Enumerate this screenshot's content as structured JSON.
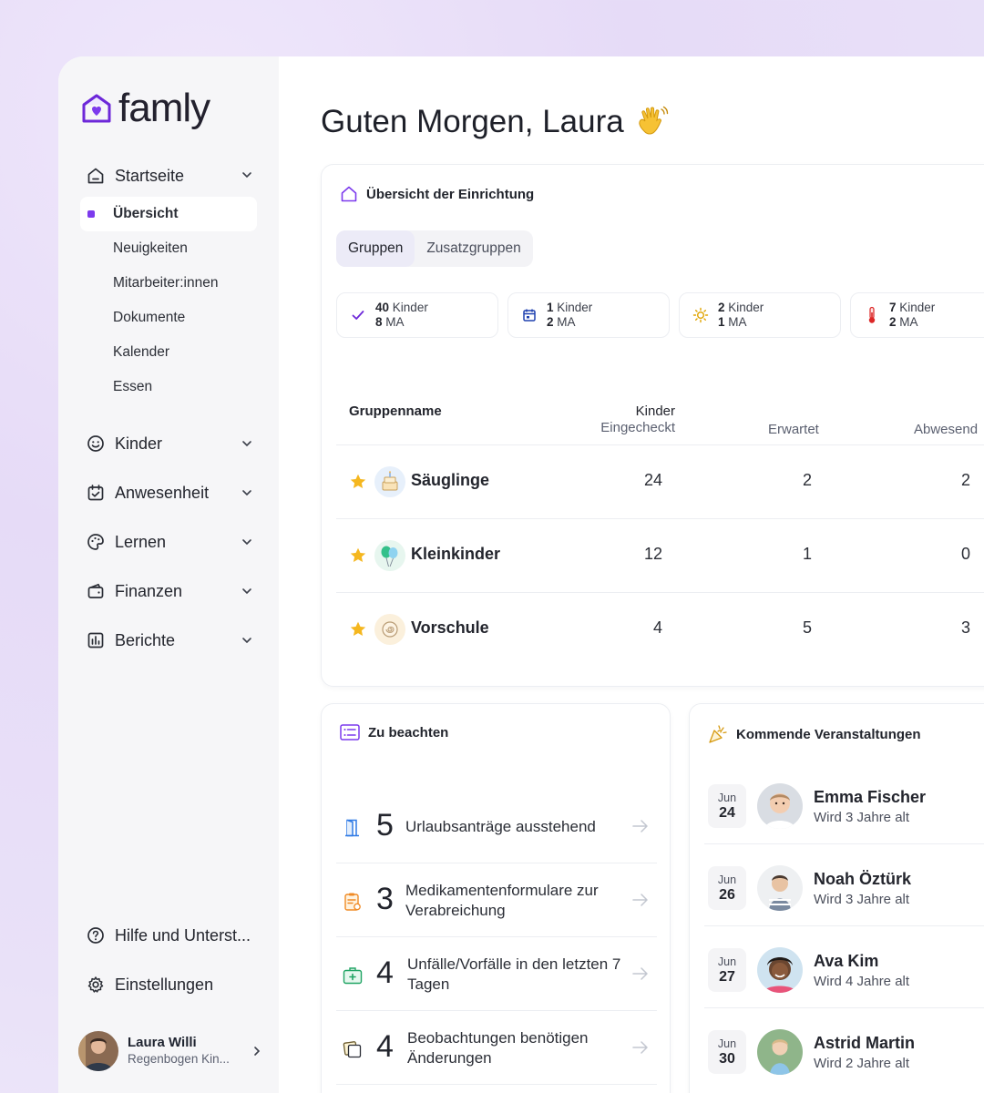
{
  "brand": {
    "name": "famly",
    "accent": "#7c3aed"
  },
  "greeting": {
    "text": "Guten Morgen, Laura"
  },
  "sidebar": {
    "home": {
      "label": "Startseite",
      "icon": "home-icon"
    },
    "subitems": [
      {
        "label": "Übersicht",
        "active": true
      },
      {
        "label": "Neuigkeiten"
      },
      {
        "label": "Mitarbeiter:innen"
      },
      {
        "label": "Dokumente"
      },
      {
        "label": "Kalender"
      },
      {
        "label": "Essen"
      }
    ],
    "sections": [
      {
        "label": "Kinder",
        "icon": "smiley-icon"
      },
      {
        "label": "Anwesenheit",
        "icon": "calendar-check-icon"
      },
      {
        "label": "Lernen",
        "icon": "palette-icon"
      },
      {
        "label": "Finanzen",
        "icon": "wallet-icon"
      },
      {
        "label": "Berichte",
        "icon": "chart-icon"
      }
    ],
    "help": {
      "label": "Hilfe und Unterst..."
    },
    "settings": {
      "label": "Einstellungen"
    },
    "profile": {
      "name": "Laura Willi",
      "org": "Regenbogen Kin..."
    }
  },
  "overview": {
    "title": "Übersicht der Einrichtung",
    "tabs": [
      {
        "label": "Gruppen",
        "active": true
      },
      {
        "label": "Zusatzgruppen"
      }
    ],
    "stats": [
      {
        "kids": "40",
        "kids_label": "Kinder",
        "staff": "8",
        "staff_label": "MA",
        "icon": "check-icon"
      },
      {
        "kids": "1",
        "kids_label": "Kinder",
        "staff": "2",
        "staff_label": "MA",
        "icon": "calendar-icon"
      },
      {
        "kids": "2",
        "kids_label": "Kinder",
        "staff": "1",
        "staff_label": "MA",
        "icon": "sun-icon"
      },
      {
        "kids": "7",
        "kids_label": "Kinder",
        "staff": "2",
        "staff_label": "MA",
        "icon": "thermometer-icon"
      }
    ],
    "columns": {
      "name": "Gruppenname",
      "checked_1": "Kinder",
      "checked_2": "Eingecheckt",
      "expected": "Erwartet",
      "absent": "Abwesend"
    },
    "rows": [
      {
        "name": "Säuglinge",
        "checked": "24",
        "expected": "2",
        "absent": "2",
        "icon": "cake-icon"
      },
      {
        "name": "Kleinkinder",
        "checked": "12",
        "expected": "1",
        "absent": "0",
        "icon": "balloon-icon"
      },
      {
        "name": "Vorschule",
        "checked": "4",
        "expected": "5",
        "absent": "3",
        "icon": "snail-icon"
      }
    ]
  },
  "attention": {
    "title": "Zu beachten",
    "items": [
      {
        "count": "5",
        "text": "Urlaubsanträge ausstehend",
        "icon": "door-icon"
      },
      {
        "count": "3",
        "text": "Medikamentenformulare zur Verabreichung",
        "icon": "clipboard-icon"
      },
      {
        "count": "4",
        "text": "Unfälle/Vorfälle in den letzten 7 Tagen",
        "icon": "first-aid-icon"
      },
      {
        "count": "4",
        "text": "Beobachtungen benötigen Änderungen",
        "icon": "notes-icon"
      }
    ]
  },
  "events": {
    "title": "Kommende Veranstaltungen",
    "items": [
      {
        "month": "Jun",
        "day": "24",
        "name": "Emma Fischer",
        "sub": "Wird 3 Jahre alt"
      },
      {
        "month": "Jun",
        "day": "26",
        "name": "Noah Öztürk",
        "sub": "Wird 3 Jahre alt"
      },
      {
        "month": "Jun",
        "day": "27",
        "name": "Ava Kim",
        "sub": "Wird 4 Jahre alt"
      },
      {
        "month": "Jun",
        "day": "30",
        "name": "Astrid Martin",
        "sub": "Wird 2 Jahre alt"
      }
    ]
  }
}
